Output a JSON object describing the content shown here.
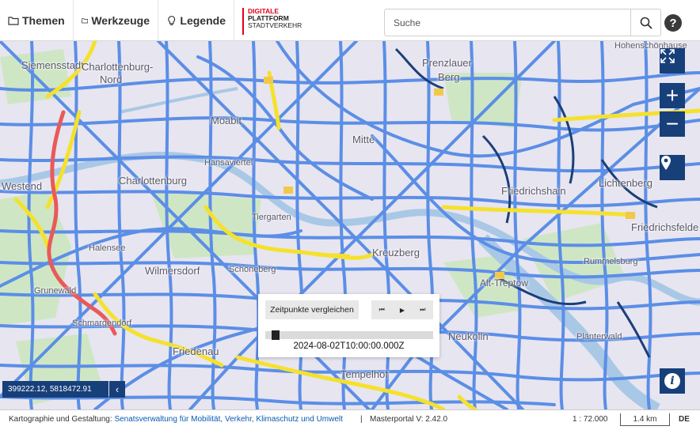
{
  "menu": {
    "themen": "Themen",
    "werkzeuge": "Werkzeuge",
    "legende": "Legende"
  },
  "logo": {
    "line1": "DIGITALE",
    "line2": "PLATTFORM",
    "line3": "STADTVERKEHR"
  },
  "search": {
    "placeholder": "Suche",
    "icon": "search-icon"
  },
  "help": {
    "label": "?"
  },
  "map": {
    "places": [
      "Siemensstadt",
      "Charlottenburg-",
      "Nord",
      "Prenzlauer",
      "Berg",
      "Moabit",
      "Mitte",
      "Hansaviertel",
      "Charlottenburg",
      "Westend",
      "Friedrichshain",
      "Lichtenberg",
      "Tiergarten",
      "Friedrichsfelde",
      "Halensee",
      "Kreuzberg",
      "Rummelsburg",
      "Grunewald",
      "Wilmersdorf",
      "Schöneberg",
      "Alt-Treptow",
      "Schmargendorf",
      "Neukölln",
      "Plänterwald",
      "Friedenau",
      "Tempelhof",
      "Hohenschönhause"
    ],
    "colors": {
      "road_flow": "#5b8ee6",
      "road_slow": "#f5e12c",
      "road_jam": "#e85a5a",
      "road_other": "#1b3f78",
      "water": "#a9c8e6",
      "green": "#cfe6c5",
      "base": "#e7e5f0"
    }
  },
  "controls": {
    "fullscreen_icon": "expand-icon",
    "zoom_in": "+",
    "zoom_out": "−",
    "locate_icon": "location-pin-icon",
    "info": "i"
  },
  "timeslider": {
    "compare_label": "Zeitpunkte vergleichen",
    "player_icons": [
      "skip-back-icon",
      "play-icon",
      "skip-forward-icon"
    ],
    "progress": 0.04,
    "timestamp": "2024-08-02T10:00:00.000Z"
  },
  "coordinates": {
    "value": "399222.12, 5818472.91",
    "toggle": "‹"
  },
  "footer": {
    "credit_label": "Kartographie und Gestaltung:",
    "credit_link": "Senatsverwaltung für Mobilität, Verkehr, Klimaschutz und Umwelt",
    "separator": "|",
    "version": "Masterportal V: 2.42.0",
    "scale": "1 : 72.000",
    "scalebar": "1.4 km",
    "language": "DE"
  }
}
